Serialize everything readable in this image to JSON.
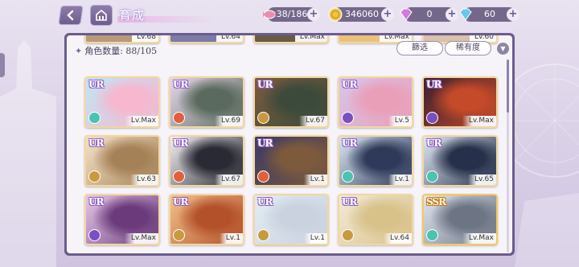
{
  "header": {
    "title": "育成"
  },
  "resources": [
    {
      "name": "stamina",
      "icon": "candy-icon",
      "value": "38/186",
      "color": "#e78fb0"
    },
    {
      "name": "coins",
      "icon": "coin-icon",
      "value": "346060",
      "color": "#f1c445"
    },
    {
      "name": "gems",
      "icon": "diamond-icon",
      "value": "0",
      "color": "#d07be0"
    },
    {
      "name": "crystals",
      "icon": "crystal-icon",
      "value": "60",
      "color": "#69c7ee"
    }
  ],
  "panel": {
    "count_label": "角色数量: 88/105",
    "filter_label": "篩选",
    "sort_label": "稀有度"
  },
  "top_strip": [
    {
      "level": "Lv.68"
    },
    {
      "level": "Lv.64"
    },
    {
      "level": "Lv.Max"
    },
    {
      "level": "Lv.Max"
    },
    {
      "level": "Lv.60"
    }
  ],
  "cards": [
    {
      "rarity": "UR",
      "level": "Lv.Max",
      "element": "wind",
      "elem_color": "#4cc2b0",
      "art": [
        "#bfe6f6",
        "#f6b7cf"
      ]
    },
    {
      "rarity": "UR",
      "level": "Lv.69",
      "element": "fire",
      "elem_color": "#e0603a",
      "art": [
        "#e6d7ea",
        "#5a6a5e"
      ]
    },
    {
      "rarity": "UR",
      "level": "Lv.67",
      "element": "earth",
      "elem_color": "#c89a3c",
      "art": [
        "#7a5b3e",
        "#3b4a3a"
      ]
    },
    {
      "rarity": "UR",
      "level": "Lv.5",
      "element": "dark",
      "elem_color": "#7a4fc0",
      "art": [
        "#d7c6ea",
        "#e99fb8"
      ]
    },
    {
      "rarity": "UR",
      "level": "Lv.Max",
      "element": "dark",
      "elem_color": "#7a4fc0",
      "art": [
        "#3a2030",
        "#c44a2a"
      ]
    },
    {
      "rarity": "UR",
      "level": "Lv.63",
      "element": "earth",
      "elem_color": "#c89a3c",
      "art": [
        "#f3e3c8",
        "#a58157"
      ]
    },
    {
      "rarity": "UR",
      "level": "Lv.67",
      "element": "fire",
      "elem_color": "#e0603a",
      "art": [
        "#f2f0f2",
        "#2a2a34"
      ]
    },
    {
      "rarity": "UR",
      "level": "Lv.1",
      "element": "fire",
      "elem_color": "#e0603a",
      "art": [
        "#3a3a66",
        "#7d5a3c"
      ]
    },
    {
      "rarity": "UR",
      "level": "Lv.1",
      "element": "wind",
      "elem_color": "#4cc2b0",
      "art": [
        "#d8e6f2",
        "#2f3a5a"
      ]
    },
    {
      "rarity": "UR",
      "level": "Lv.65",
      "element": "wind",
      "elem_color": "#4cc2b0",
      "art": [
        "#dfe8f2",
        "#26304a"
      ]
    },
    {
      "rarity": "UR",
      "level": "Lv.Max",
      "element": "dark",
      "elem_color": "#7a4fc0",
      "art": [
        "#e6c6e8",
        "#6a3a7a"
      ]
    },
    {
      "rarity": "UR",
      "level": "Lv.1",
      "element": "earth",
      "elem_color": "#c89a3c",
      "art": [
        "#f2c08a",
        "#b3522a"
      ]
    },
    {
      "rarity": "UR",
      "level": "Lv.1",
      "element": "earth",
      "elem_color": "#c89a3c",
      "art": [
        "#e2ecf2",
        "#c9d2de"
      ]
    },
    {
      "rarity": "UR",
      "level": "Lv.64",
      "element": "earth",
      "elem_color": "#c89a3c",
      "art": [
        "#f3ead8",
        "#d8c28a"
      ]
    },
    {
      "rarity": "SSR",
      "level": "Lv.Max",
      "element": "wind",
      "elem_color": "#4cc2b0",
      "art": [
        "#dfe6ee",
        "#6d7484"
      ]
    }
  ]
}
